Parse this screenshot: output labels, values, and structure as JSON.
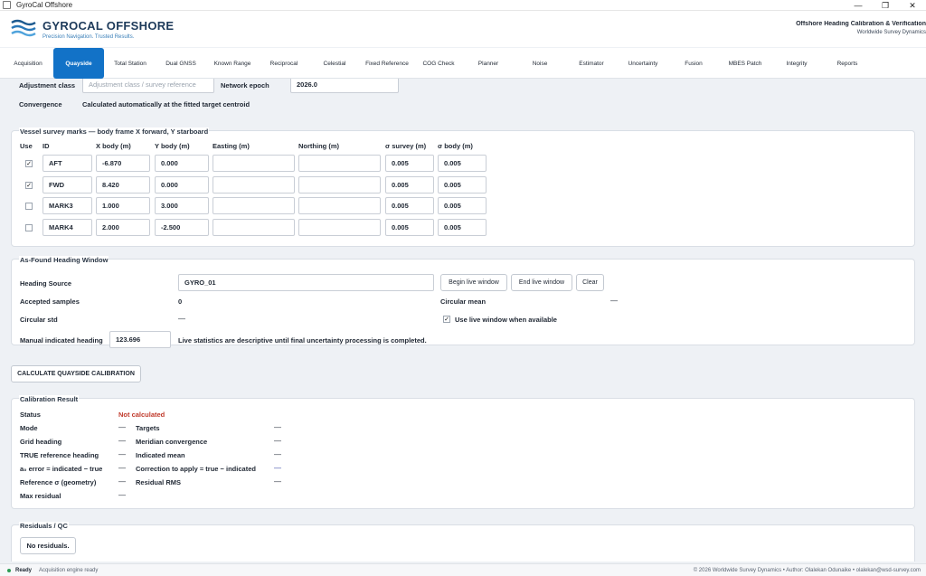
{
  "window": {
    "title": "GyroCal Offshore"
  },
  "brand": {
    "title": "GYROCAL OFFSHORE",
    "tagline": "Precision Navigation. Trusted Results."
  },
  "header_right": {
    "title": "Offshore Heading Calibration & Verification",
    "subtitle": "Worldwide Survey Dynamics"
  },
  "tabs": [
    "Acquisition",
    "Quayside",
    "Total Station",
    "Dual GNSS",
    "Known Range",
    "Reciprocal",
    "Celestial",
    "Fixed Reference",
    "COG Check",
    "Planner",
    "Noise",
    "Estimator",
    "Uncertainty",
    "Fusion",
    "MBES Patch",
    "Integrity",
    "Reports"
  ],
  "active_tab": "Quayside",
  "top": {
    "adjustment_class_label": "Adjustment class",
    "adjustment_class_placeholder": "Adjustment class / survey reference",
    "network_epoch_label": "Network epoch",
    "network_epoch_value": "2026.0",
    "convergence_label": "Convergence",
    "convergence_value": "Calculated automatically at the fitted target centroid"
  },
  "marks": {
    "title": "Vessel survey marks — body frame X forward, Y starboard",
    "headers": [
      "Use",
      "ID",
      "X body (m)",
      "Y body (m)",
      "Easting (m)",
      "Northing (m)",
      "σ survey (m)",
      "σ body (m)"
    ],
    "rows": [
      {
        "use": "✓",
        "id": "AFT",
        "x": "-6.870",
        "y": "0.000",
        "e": "",
        "n": "",
        "ss": "0.005",
        "sb": "0.005"
      },
      {
        "use": "✓",
        "id": "FWD",
        "x": "8.420",
        "y": "0.000",
        "e": "",
        "n": "",
        "ss": "0.005",
        "sb": "0.005"
      },
      {
        "use": "",
        "id": "MARK3",
        "x": "1.000",
        "y": "3.000",
        "e": "",
        "n": "",
        "ss": "0.005",
        "sb": "0.005"
      },
      {
        "use": "",
        "id": "MARK4",
        "x": "2.000",
        "y": "-2.500",
        "e": "",
        "n": "",
        "ss": "0.005",
        "sb": "0.005"
      }
    ]
  },
  "asfound": {
    "title": "As-Found Heading Window",
    "heading_source_label": "Heading Source",
    "heading_source_value": "GYRO_01",
    "begin_btn": "Begin live window",
    "end_btn": "End live window",
    "clear_btn": "Clear",
    "accepted_label": "Accepted samples",
    "accepted_value": "0",
    "circ_mean_label": "Circular mean",
    "circ_mean_value": "—",
    "circ_std_label": "Circular std",
    "circ_std_value": "—",
    "use_live_check": "✓",
    "use_live_label": "Use live window when available",
    "manual_label": "Manual indicated heading",
    "manual_value": "123.696",
    "note": "Live statistics are descriptive until final uncertainty processing is completed."
  },
  "calc_button": "CALCULATE QUAYSIDE CALIBRATION",
  "result": {
    "title": "Calibration Result",
    "status_label": "Status",
    "status_value": "Not calculated",
    "left": [
      {
        "label": "Mode",
        "value": "—"
      },
      {
        "label": "Grid heading",
        "value": "—"
      },
      {
        "label": "TRUE reference heading",
        "value": "—"
      },
      {
        "label": "a₀ error = indicated − true",
        "value": "—"
      },
      {
        "label": "Reference σ (geometry)",
        "value": "—"
      },
      {
        "label": "Max residual",
        "value": "—"
      }
    ],
    "right": [
      {
        "label": "Targets",
        "value": "—"
      },
      {
        "label": "Meridian convergence",
        "value": "—"
      },
      {
        "label": "Indicated mean",
        "value": "—"
      },
      {
        "label": "Correction to apply = true − indicated",
        "value": "—"
      },
      {
        "label": "Residual RMS",
        "value": "—"
      }
    ]
  },
  "residuals": {
    "title": "Residuals / QC",
    "empty": "No residuals."
  },
  "status": {
    "state": "Ready",
    "message": "Acquisition engine ready",
    "footer": "© 2026 Worldwide Survey Dynamics • Author: Olalekan Odunaike • olalekan@wsd-survey.com"
  },
  "colors": {
    "accent": "#1272c7",
    "brand": "#1d3a5a",
    "error": "#c03a2b",
    "ok": "#2e9b55"
  }
}
